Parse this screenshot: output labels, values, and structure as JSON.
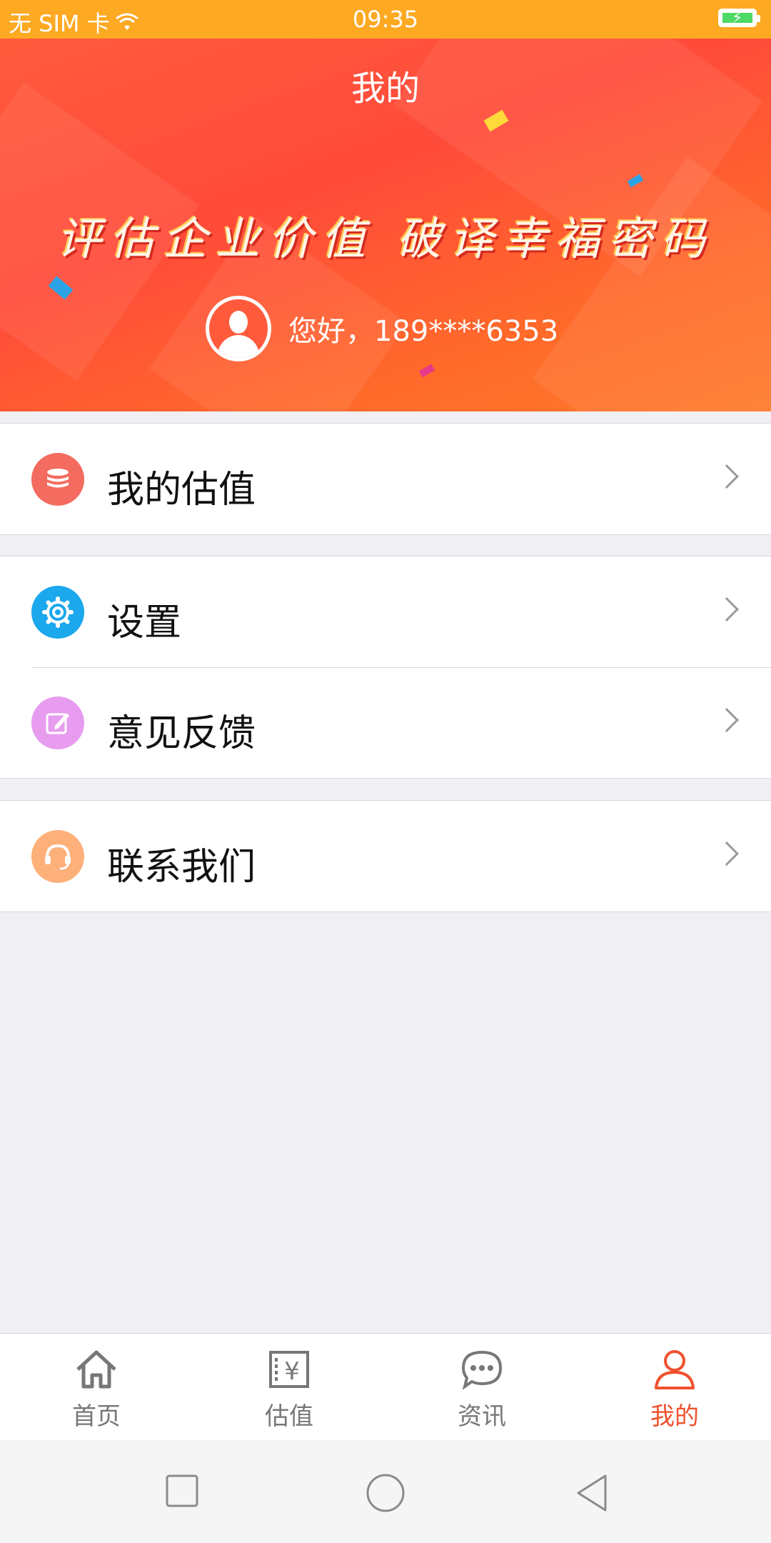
{
  "status_bar": {
    "carrier": "无 SIM 卡",
    "time": "09:35"
  },
  "header": {
    "title": "我的",
    "slogan": "评估企业价值  破译幸福密码",
    "greeting": "您好，189****6353"
  },
  "menu": {
    "group1": [
      {
        "label": "我的估值",
        "icon": "coins-icon",
        "color": "#f46b5f"
      }
    ],
    "group2": [
      {
        "label": "设置",
        "icon": "gear-icon",
        "color": "#1ba8ec"
      },
      {
        "label": "意见反馈",
        "icon": "edit-icon",
        "color": "#e79cf0"
      }
    ],
    "group3": [
      {
        "label": "联系我们",
        "icon": "headset-icon",
        "color": "#fdb07a"
      }
    ]
  },
  "tabbar": {
    "items": [
      {
        "label": "首页",
        "icon": "home-icon"
      },
      {
        "label": "估值",
        "icon": "yen-ledger-icon"
      },
      {
        "label": "资讯",
        "icon": "chat-bubble-icon"
      },
      {
        "label": "我的",
        "icon": "person-icon"
      }
    ],
    "active_index": 3,
    "active_color": "#f0512f"
  }
}
